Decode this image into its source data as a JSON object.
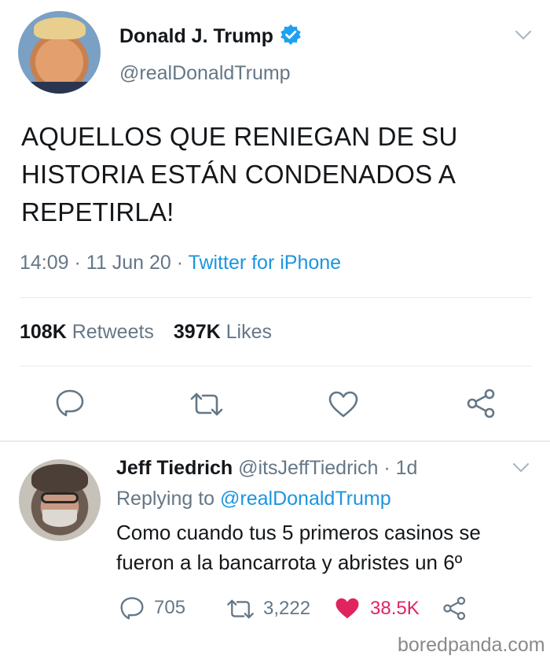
{
  "tweet": {
    "author_name": "Donald J. Trump",
    "author_handle": "@realDonaldTrump",
    "verified": true,
    "text_lines": [
      "AQUELLOS QUE RENIEGAN DE SU",
      "HISTORIA ESTÁN CONDENADOS A",
      "REPETIRLA!"
    ],
    "time": "14:09",
    "sep1": "·",
    "date": "11 Jun 20",
    "sep2": "·",
    "source": "Twitter for iPhone",
    "retweets_count": "108K",
    "retweets_label": "Retweets",
    "likes_count": "397K",
    "likes_label": "Likes",
    "actions": [
      "reply-icon",
      "retweet-icon",
      "like-icon",
      "share-icon"
    ]
  },
  "reply": {
    "author_name": "Jeff Tiedrich",
    "author_handle": "@itsJeffTiedrich",
    "sep": "·",
    "age": "1d",
    "replying_label": "Replying to",
    "replying_handle": "@realDonaldTrump",
    "text_lines": [
      "Como cuando tus 5 primeros casinos se",
      "fueron a la bancarrota y abristes un 6º"
    ],
    "reply_count": "705",
    "retweet_count": "3,222",
    "like_count": "38.5K",
    "liked": true
  },
  "watermark": "boredpanda.com",
  "colors": {
    "link": "#1b95e0",
    "muted": "#657786",
    "like": "#e0245e",
    "verified": "#1da1f2",
    "divider": "#e6ecf0"
  }
}
